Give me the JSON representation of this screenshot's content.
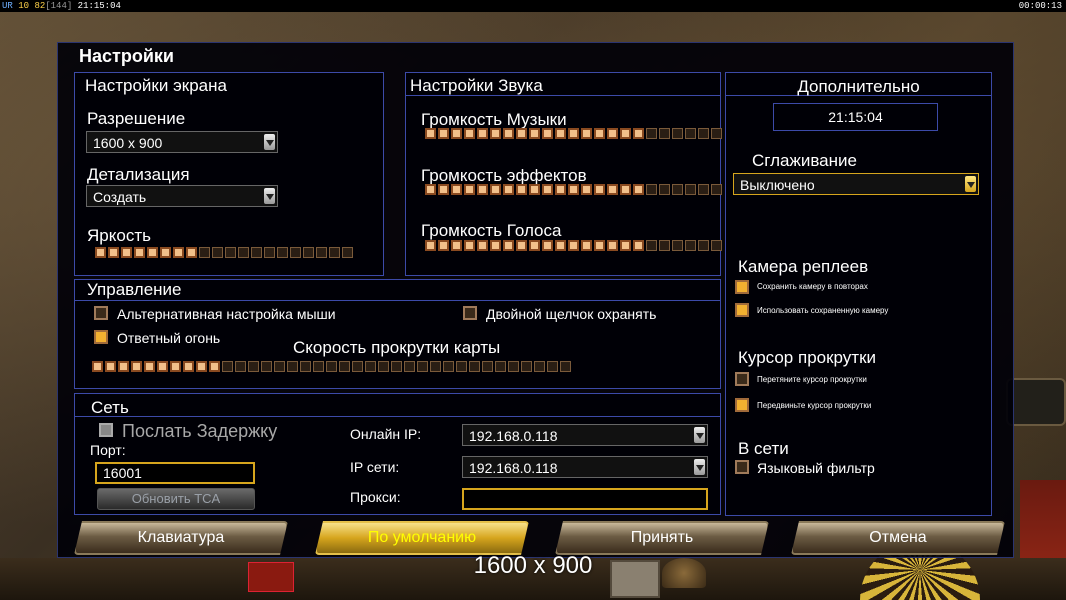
{
  "hud": {
    "left_prefix": "UR",
    "left_num1": "10",
    "left_num2": "82",
    "left_num3": "[144]",
    "left_time": "21:15:04",
    "right_time": "00:00:13"
  },
  "window": {
    "title": "Настройки"
  },
  "screen": {
    "heading": "Настройки экрана",
    "resolution_label": "Разрешение",
    "resolution_value": "1600 x 900",
    "detail_label": "Детализация",
    "detail_value": "Создать",
    "brightness_label": "Яркость",
    "brightness": {
      "filled": 8,
      "total": 20
    }
  },
  "sound": {
    "heading": "Настройки Звука",
    "music_label": "Громкость Музыки",
    "music": {
      "filled": 17,
      "total": 23
    },
    "effects_label": "Громкость эффектов",
    "effects": {
      "filled": 17,
      "total": 23
    },
    "voice_label": "Громкость Голоса",
    "voice": {
      "filled": 17,
      "total": 23
    }
  },
  "extra": {
    "heading": "Дополнительно",
    "clock": "21:15:04",
    "aa_label": "Сглаживание",
    "aa_value": "Выключено",
    "replay_cam_heading": "Камера реплеев",
    "replay_opt1": "Сохранить камеру в повторах",
    "replay_opt2": "Использовать сохраненную камеру",
    "scroll_cursor_heading": "Курсор прокрутки",
    "scroll_opt1": "Перетяните курсор прокрутки",
    "scroll_opt2": "Передвиньте курсор прокрутки",
    "online_heading": "В сети",
    "lang_filter": "Языковый фильтр"
  },
  "control": {
    "heading": "Управление",
    "alt_mouse": "Альтернативная настройка мыши",
    "double_click": "Двойной щелчок охранять",
    "retaliation": "Ответный огонь",
    "scroll_speed_label": "Скорость прокрутки карты",
    "scroll_speed": {
      "filled": 10,
      "total": 37
    }
  },
  "network": {
    "heading": "Сеть",
    "send_delay": "Послать Задержку",
    "port_label": "Порт:",
    "port_value": "16001",
    "update_tca": "Обновить TCA",
    "online_ip_label": "Онлайн IP:",
    "online_ip_value": "192.168.0.118",
    "lan_ip_label": "IP сети:",
    "lan_ip_value": "192.168.0.118",
    "proxy_label": "Прокси:",
    "proxy_value": ""
  },
  "buttons": {
    "keyboard": "Клавиатура",
    "defaults": "По умолчанию",
    "accept": "Принять",
    "cancel": "Отмена"
  },
  "caption": "1600 x 900",
  "colors": {
    "accent_gold": "#d6a51d",
    "panel_border": "#3c4aa8",
    "slider_on": "#f2c08a"
  }
}
